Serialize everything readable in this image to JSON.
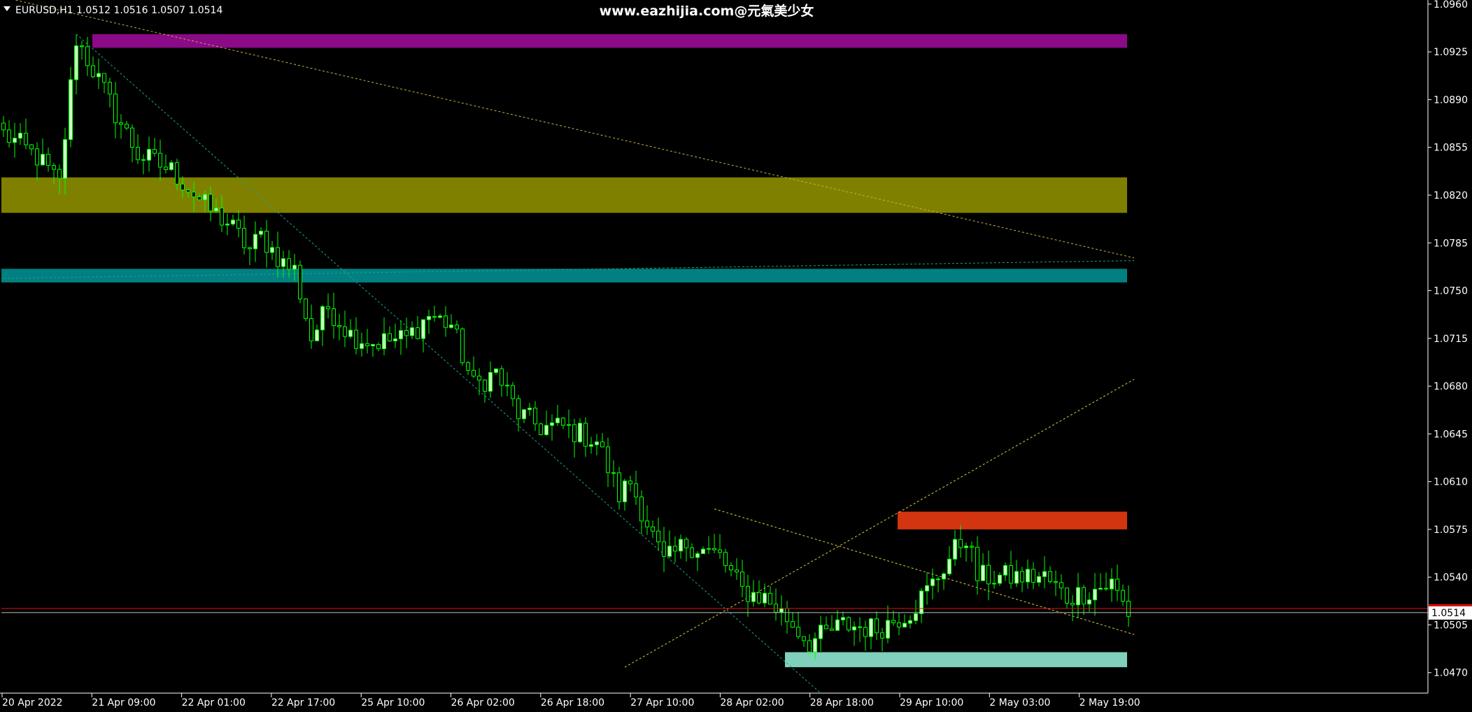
{
  "header": {
    "symbol_text": "EURUSD,H1  1.0512 1.0516 1.0507 1.0514",
    "watermark": "www.eazhijia.com@元氣美少女"
  },
  "colors": {
    "background": "#000000",
    "bull_candle": "#c8ffc0",
    "bear_candle": "#000000",
    "wick": "#00ff00",
    "axis": "#ffffff",
    "bid_line": "#e01010",
    "price_label_bg": "#ffffff"
  },
  "current_price": "1.0514",
  "chart_data": {
    "type": "candlestick",
    "symbol": "EURUSD",
    "timeframe": "H1",
    "ylim": [
      1.0455,
      1.0962
    ],
    "y_ticks": [
      "1.0960",
      "1.0925",
      "1.0890",
      "1.0855",
      "1.0820",
      "1.0785",
      "1.0750",
      "1.0715",
      "1.0680",
      "1.0645",
      "1.0610",
      "1.0575",
      "1.0540",
      "1.0505",
      "1.0470"
    ],
    "x_ticks": [
      "20 Apr 2022",
      "21 Apr 09:00",
      "22 Apr 01:00",
      "22 Apr 17:00",
      "25 Apr 10:00",
      "26 Apr 02:00",
      "26 Apr 18:00",
      "27 Apr 10:00",
      "28 Apr 02:00",
      "28 Apr 18:00",
      "29 Apr 10:00",
      "2 May 03:00",
      "2 May 19:00"
    ],
    "bars_visible": 202,
    "last_bar_index": 201,
    "ohlc_anchors": [
      [
        0,
        1.0865
      ],
      [
        6,
        1.0848
      ],
      [
        10,
        1.0828
      ],
      [
        13,
        1.0935
      ],
      [
        16,
        1.0912
      ],
      [
        20,
        1.088
      ],
      [
        24,
        1.085
      ],
      [
        30,
        1.0838
      ],
      [
        32,
        1.083
      ],
      [
        36,
        1.0812
      ],
      [
        40,
        1.08
      ],
      [
        44,
        1.078
      ],
      [
        46,
        1.079
      ],
      [
        50,
        1.077
      ],
      [
        52,
        1.0765
      ],
      [
        55,
        1.0715
      ],
      [
        58,
        1.0738
      ],
      [
        62,
        1.0718
      ],
      [
        66,
        1.0712
      ],
      [
        72,
        1.0715
      ],
      [
        76,
        1.0732
      ],
      [
        80,
        1.0725
      ],
      [
        84,
        1.068
      ],
      [
        88,
        1.069
      ],
      [
        92,
        1.066
      ],
      [
        96,
        1.065
      ],
      [
        100,
        1.065
      ],
      [
        106,
        1.064
      ],
      [
        110,
        1.06
      ],
      [
        112,
        1.061
      ],
      [
        118,
        1.055
      ],
      [
        122,
        1.0565
      ],
      [
        128,
        1.0555
      ],
      [
        132,
        1.053
      ],
      [
        136,
        1.0525
      ],
      [
        140,
        1.051
      ],
      [
        144,
        1.0492
      ],
      [
        150,
        1.0505
      ],
      [
        156,
        1.0502
      ],
      [
        162,
        1.0515
      ],
      [
        166,
        1.0535
      ],
      [
        170,
        1.056
      ],
      [
        172,
        1.057
      ],
      [
        174,
        1.054
      ],
      [
        178,
        1.054
      ],
      [
        182,
        1.054
      ],
      [
        186,
        1.054
      ],
      [
        190,
        1.0525
      ],
      [
        194,
        1.053
      ],
      [
        198,
        1.0535
      ],
      [
        201,
        1.0514
      ]
    ],
    "zones": [
      {
        "color": "#8b0a87",
        "low": 1.0928,
        "high": 1.0938
      },
      {
        "color": "#808000",
        "low": 1.0807,
        "high": 1.0833
      },
      {
        "color": "#008080",
        "low": 1.0756,
        "high": 1.0766
      },
      {
        "color": "#d2350f",
        "low": 1.0575,
        "high": 1.0588
      },
      {
        "color": "#7fd1bc",
        "low": 1.0474,
        "high": 1.0485
      }
    ],
    "trendlines": [
      {
        "color": "#c8b040",
        "from": [
          0,
          1.0965
        ],
        "to": [
          202,
          1.0774
        ]
      },
      {
        "color": "#20a090",
        "from": [
          13,
          1.0938
        ],
        "to": [
          146,
          1.0455
        ]
      },
      {
        "color": "#20a090",
        "from": [
          0,
          1.0759
        ],
        "to": [
          202,
          1.0772
        ]
      },
      {
        "color": "#d8d040",
        "from": [
          111,
          1.0474
        ],
        "to": [
          202,
          1.0685
        ]
      },
      {
        "color": "#d8d040",
        "from": [
          127,
          1.059
        ],
        "to": [
          202,
          1.0498
        ]
      }
    ]
  }
}
